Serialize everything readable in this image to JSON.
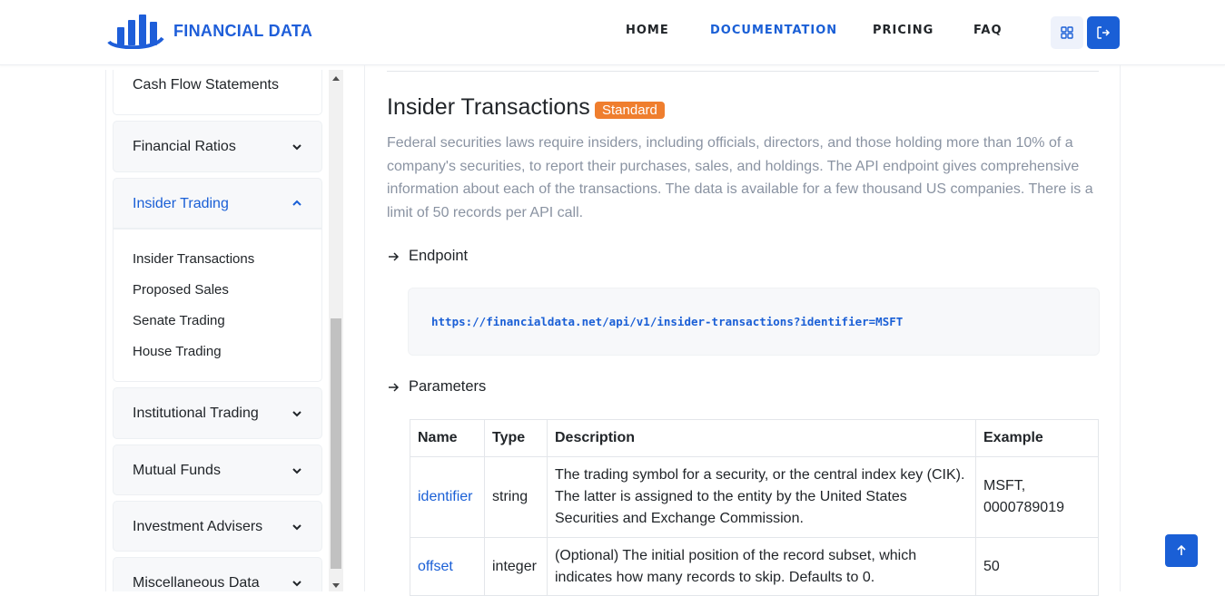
{
  "header": {
    "logo_text": "FINANCIAL DATA",
    "nav": [
      "HOME",
      "DOCUMENTATION",
      "PRICING",
      "FAQ"
    ],
    "active_nav": "DOCUMENTATION",
    "icons": [
      "grid-icon",
      "logout-icon"
    ]
  },
  "sidebar": {
    "sections": [
      {
        "label": "Cash Flow Statements",
        "kind": "sub"
      },
      {
        "label": "Financial Ratios",
        "expanded": false
      },
      {
        "label": "Insider Trading",
        "expanded": true,
        "items": [
          "Insider Transactions",
          "Proposed Sales",
          "Senate Trading",
          "House Trading"
        ]
      },
      {
        "label": "Institutional Trading",
        "expanded": false
      },
      {
        "label": "Mutual Funds",
        "expanded": false
      },
      {
        "label": "Investment Advisers",
        "expanded": false
      },
      {
        "label": "Miscellaneous Data",
        "expanded": false
      }
    ]
  },
  "content": {
    "title": "Insider Transactions",
    "badge": "Standard",
    "description": "Federal securities laws require insiders, including officials, directors, and those holding more than 10% of a company's securities, to report their purchases, sales, and holdings. The API endpoint gives comprehensive information about each of the transactions. The data is available for a few thousand US companies. There is a limit of 50 records per API call.",
    "endpoint_heading": "Endpoint",
    "endpoint_url": "https://financialdata.net/api/v1/insider-transactions?identifier=MSFT",
    "parameters_heading": "Parameters",
    "table": {
      "headers": [
        "Name",
        "Type",
        "Description",
        "Example"
      ],
      "rows": [
        [
          "identifier",
          "string",
          "The trading symbol for a security, or the central index key (CIK). The latter is assigned to the entity by the United States Securities and Exchange Commission.",
          "MSFT, 0000789019"
        ],
        [
          "offset",
          "integer",
          "(Optional) The initial position of the record subset, which indicates how many records to skip. Defaults to 0.",
          "50"
        ]
      ]
    }
  },
  "colors": {
    "accent": "#1a5fd6",
    "badge": "#ef7e2e",
    "muted": "#8a93a2"
  }
}
